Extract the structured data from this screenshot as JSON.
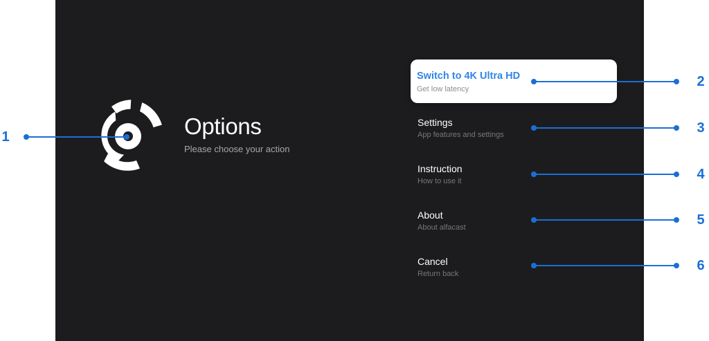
{
  "header": {
    "title": "Options",
    "subtitle": "Please choose your action"
  },
  "icons": {
    "logo": "alfacast-logo-icon"
  },
  "menu": {
    "items": [
      {
        "label": "Switch to 4K Ultra HD",
        "description": "Get low latency",
        "selected": true
      },
      {
        "label": "Settings",
        "description": "App features and settings"
      },
      {
        "label": "Instruction",
        "description": "How to use it"
      },
      {
        "label": "About",
        "description": "About alfacast"
      },
      {
        "label": "Cancel",
        "description": "Return back"
      }
    ]
  },
  "annotations": {
    "markers": [
      "1",
      "2",
      "3",
      "4",
      "5",
      "6"
    ]
  },
  "colors": {
    "background": "#1c1c1e",
    "accent": "#2f86e6",
    "annotation": "#1a6fd6",
    "card": "#ffffff"
  }
}
